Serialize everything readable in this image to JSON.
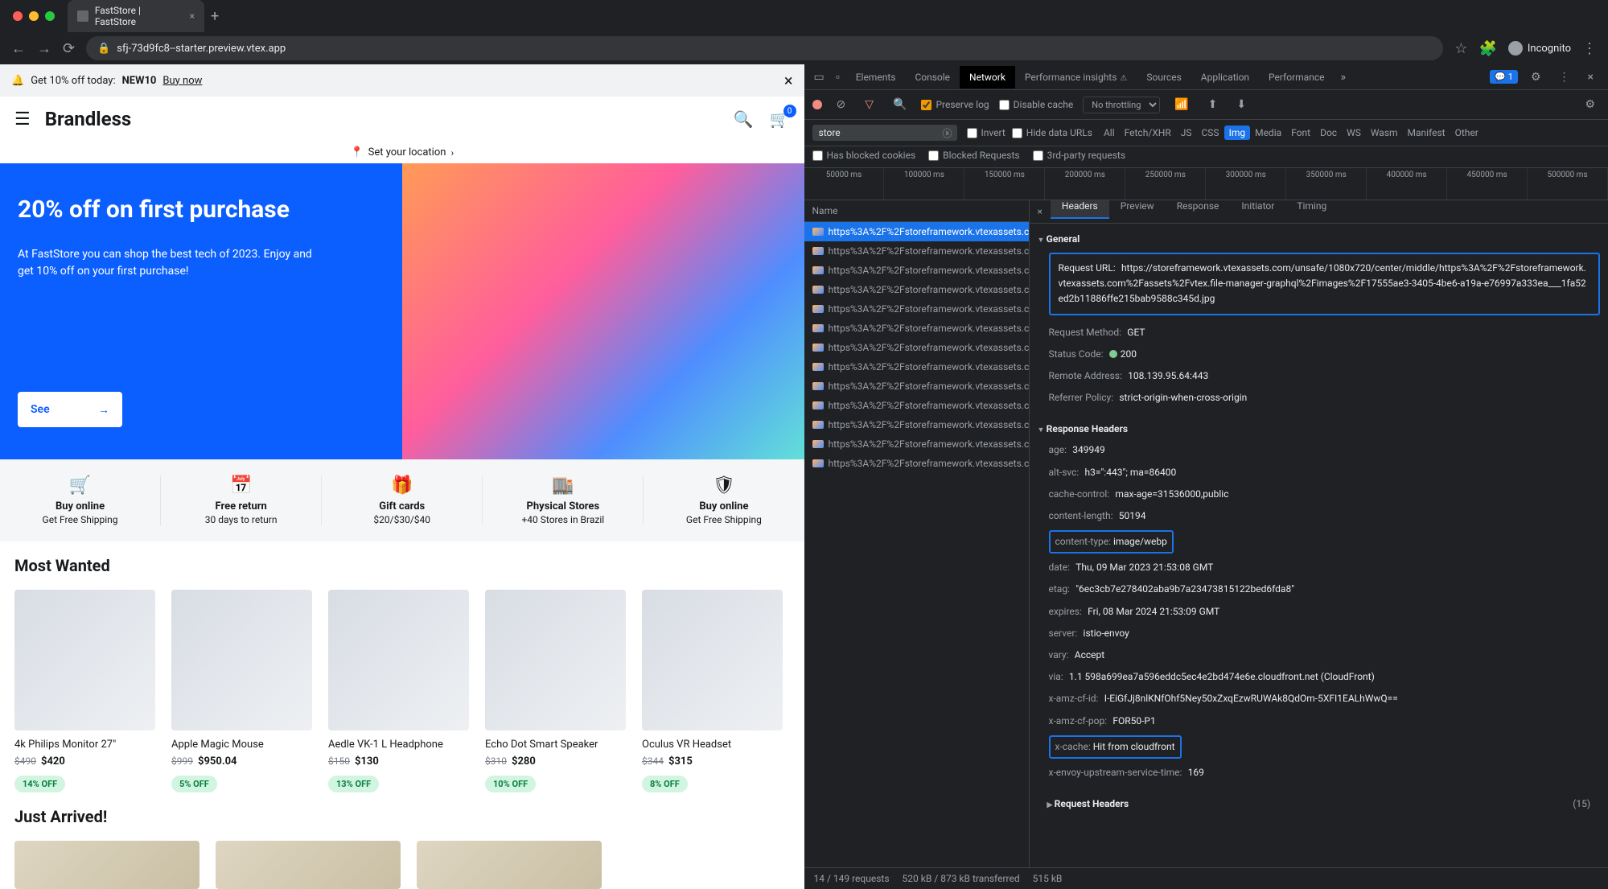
{
  "browser": {
    "tab_title": "FastStore | FastStore",
    "url": "sfj-73d9fc8--starter.preview.vtex.app",
    "incognito_label": "Incognito"
  },
  "page": {
    "promo": {
      "prefix": "Get 10% off today:",
      "code": "NEW10",
      "link": "Buy now"
    },
    "brand": "Brandless",
    "cart_count": "0",
    "location_label": "Set your location",
    "hero": {
      "title": "20% off on first purchase",
      "body": "At FastStore you can shop the best tech of 2023. Enjoy and get 10% off on your first purchase!",
      "button": "See"
    },
    "features": [
      {
        "icon": "🛒",
        "title": "Buy online",
        "sub": "Get Free Shipping"
      },
      {
        "icon": "📅",
        "title": "Free return",
        "sub": "30 days to return"
      },
      {
        "icon": "🎁",
        "title": "Gift cards",
        "sub": "$20/$30/$40"
      },
      {
        "icon": "🏬",
        "title": "Physical Stores",
        "sub": "+40 Stores in Brazil"
      },
      {
        "icon": "🛡",
        "title": "Buy online",
        "sub": "Get Free Shipping"
      }
    ],
    "most_wanted_title": "Most Wanted",
    "products": [
      {
        "name": "4k Philips Monitor 27\"",
        "old": "$490",
        "new": "$420",
        "off": "14% OFF"
      },
      {
        "name": "Apple Magic Mouse",
        "old": "$999",
        "new": "$950.04",
        "off": "5% OFF"
      },
      {
        "name": "Aedle VK-1 L Headphone",
        "old": "$150",
        "new": "$130",
        "off": "13% OFF"
      },
      {
        "name": "Echo Dot Smart Speaker",
        "old": "$310",
        "new": "$280",
        "off": "10% OFF"
      },
      {
        "name": "Oculus VR Headset",
        "old": "$344",
        "new": "$315",
        "off": "8% OFF"
      }
    ],
    "just_arrived_title": "Just Arrived!"
  },
  "devtools": {
    "tabs": [
      "Elements",
      "Console",
      "Network",
      "Performance insights",
      "Sources",
      "Application",
      "Performance"
    ],
    "active_tab": "Network",
    "msg_count": "1",
    "toolbar": {
      "preserve_log": "Preserve log",
      "disable_cache": "Disable cache",
      "throttling": "No throttling"
    },
    "filter_value": "store",
    "filters": {
      "invert": "Invert",
      "hide": "Hide data URLs"
    },
    "types": [
      "All",
      "Fetch/XHR",
      "JS",
      "CSS",
      "Img",
      "Media",
      "Font",
      "Doc",
      "WS",
      "Wasm",
      "Manifest",
      "Other"
    ],
    "active_type": "Img",
    "row2": {
      "blocked_cookies": "Has blocked cookies",
      "blocked_req": "Blocked Requests",
      "third": "3rd-party requests"
    },
    "timeline": [
      "50000 ms",
      "100000 ms",
      "150000 ms",
      "200000 ms",
      "250000 ms",
      "300000 ms",
      "350000 ms",
      "400000 ms",
      "450000 ms",
      "500000 ms"
    ],
    "name_header": "Name",
    "requests": [
      "https%3A%2F%2Fstoreframework.vtexassets.com…",
      "https%3A%2F%2Fstoreframework.vtexassets.com…",
      "https%3A%2F%2Fstoreframework.vtexassets.com…",
      "https%3A%2F%2Fstoreframework.vtexassets.com…",
      "https%3A%2F%2Fstoreframework.vtexassets.com…",
      "https%3A%2F%2Fstoreframework.vtexassets.com…",
      "https%3A%2F%2Fstoreframework.vtexassets.com…",
      "https%3A%2F%2Fstoreframework.vtexassets.com…",
      "https%3A%2F%2Fstoreframework.vtexassets.com…",
      "https%3A%2F%2Fstoreframework.vtexassets.com…",
      "https%3A%2F%2Fstoreframework.vtexassets.com…",
      "https%3A%2F%2Fstoreframework.vtexassets.com…",
      "https%3A%2F%2Fstoreframework.vtexassets.com…"
    ],
    "selected_request": 0,
    "detail_tabs": [
      "Headers",
      "Preview",
      "Response",
      "Initiator",
      "Timing"
    ],
    "active_detail_tab": "Headers",
    "sections": {
      "general_title": "General",
      "request_url_label": "Request URL:",
      "request_url": "https://storeframework.vtexassets.com/unsafe/1080x720/center/middle/https%3A%2F%2Fstoreframework.vtexassets.com%2Fassets%2Fvtex.file-manager-graphql%2Fimages%2F17555ae3-3405-4be6-a19a-e76997a333ea___1fa52ed2b11886ffe215bab9588c345d.jpg",
      "method_label": "Request Method:",
      "method": "GET",
      "status_label": "Status Code:",
      "status": "200",
      "remote_label": "Remote Address:",
      "remote": "108.139.95.64:443",
      "referrer_label": "Referrer Policy:",
      "referrer": "strict-origin-when-cross-origin",
      "response_title": "Response Headers",
      "resp": [
        {
          "k": "age:",
          "v": "349949"
        },
        {
          "k": "alt-svc:",
          "v": "h3=\":443\"; ma=86400"
        },
        {
          "k": "cache-control:",
          "v": "max-age=31536000,public"
        },
        {
          "k": "content-length:",
          "v": "50194"
        },
        {
          "k": "content-type:",
          "v": "image/webp",
          "hl": true
        },
        {
          "k": "date:",
          "v": "Thu, 09 Mar 2023 21:53:08 GMT"
        },
        {
          "k": "etag:",
          "v": "\"6ec3cb7e278402aba9b7a23473815122bed6fda8\""
        },
        {
          "k": "expires:",
          "v": "Fri, 08 Mar 2024 21:53:09 GMT"
        },
        {
          "k": "server:",
          "v": "istio-envoy"
        },
        {
          "k": "vary:",
          "v": "Accept"
        },
        {
          "k": "via:",
          "v": "1.1 598a699ea7a596eddc5ec4e2bd474e6e.cloudfront.net (CloudFront)"
        },
        {
          "k": "x-amz-cf-id:",
          "v": "I-EiGfJj8nlKNfOhf5Ney50xZxqEzwRUWAk8QdOm-5XFI1EALhWwQ=="
        },
        {
          "k": "x-amz-cf-pop:",
          "v": "FOR50-P1"
        },
        {
          "k": "x-cache:",
          "v": "Hit from cloudfront",
          "hl": true
        },
        {
          "k": "x-envoy-upstream-service-time:",
          "v": "169"
        }
      ],
      "request_title": "Request Headers",
      "request_count": "(15)"
    },
    "status_bar": {
      "reqs": "14 / 149 requests",
      "transfer": "520 kB / 873 kB transferred",
      "res": "515 kB"
    }
  }
}
